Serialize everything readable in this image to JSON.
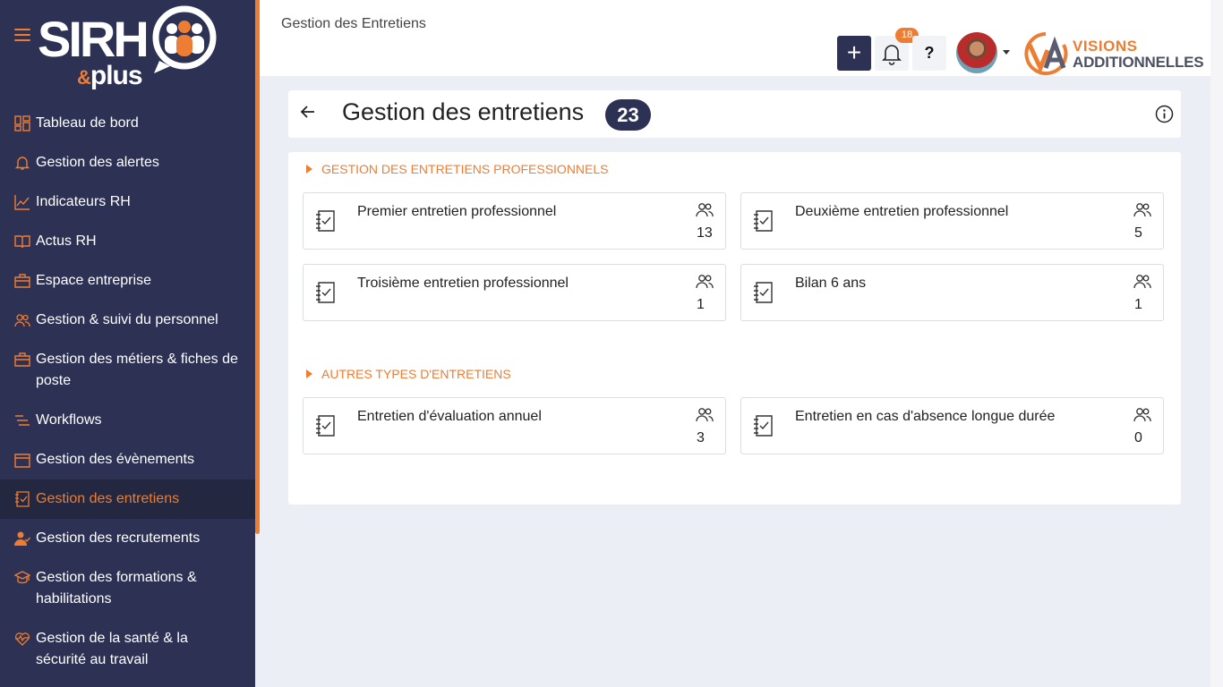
{
  "brand": {
    "logo_main": "SIRH",
    "logo_amp": "&",
    "logo_sub": "plus",
    "accent": "#ee7d34",
    "sidebar_bg": "#2d3254"
  },
  "sidebar": {
    "items": [
      {
        "label": "Tableau de bord",
        "icon": "dashboard-icon"
      },
      {
        "label": "Gestion des alertes",
        "icon": "bell-icon"
      },
      {
        "label": "Indicateurs RH",
        "icon": "line-chart-icon"
      },
      {
        "label": "Actus RH",
        "icon": "book-icon"
      },
      {
        "label": "Espace entreprise",
        "icon": "briefcase-icon"
      },
      {
        "label": "Gestion & suivi du personnel",
        "icon": "users-icon"
      },
      {
        "label": "Gestion des métiers & fiches de poste",
        "icon": "briefcase-icon"
      },
      {
        "label": "Workflows",
        "icon": "list-icon"
      },
      {
        "label": "Gestion des évènements",
        "icon": "calendar-icon"
      },
      {
        "label": "Gestion des entretiens",
        "icon": "checklist-icon",
        "active": true
      },
      {
        "label": "Gestion des recrutements",
        "icon": "user-check-icon"
      },
      {
        "label": "Gestion des formations & habilitations",
        "icon": "graduation-cap-icon"
      },
      {
        "label": "Gestion de la santé & la sécurité au travail",
        "icon": "heart-pulse-icon"
      }
    ]
  },
  "topbar": {
    "breadcrumb": "Gestion des Entretiens",
    "add_label": "+",
    "notif_count": "18",
    "help_label": "?",
    "company_line1": "VISIONS",
    "company_line2": "ADDITIONNELLES"
  },
  "page": {
    "title": "Gestion des entretiens",
    "count": "23"
  },
  "sections": [
    {
      "title": "GESTION DES ENTRETIENS PROFESSIONNELS",
      "tiles": [
        {
          "label": "Premier entretien professionnel",
          "count": "13"
        },
        {
          "label": "Deuxième entretien professionnel",
          "count": "5"
        },
        {
          "label": "Troisième entretien professionnel",
          "count": "1"
        },
        {
          "label": "Bilan 6 ans",
          "count": "1"
        }
      ]
    },
    {
      "title": "AUTRES TYPES D'ENTRETIENS",
      "tiles": [
        {
          "label": "Entretien d'évaluation annuel",
          "count": "3"
        },
        {
          "label": "Entretien en cas d'absence longue durée",
          "count": "0"
        }
      ]
    }
  ]
}
